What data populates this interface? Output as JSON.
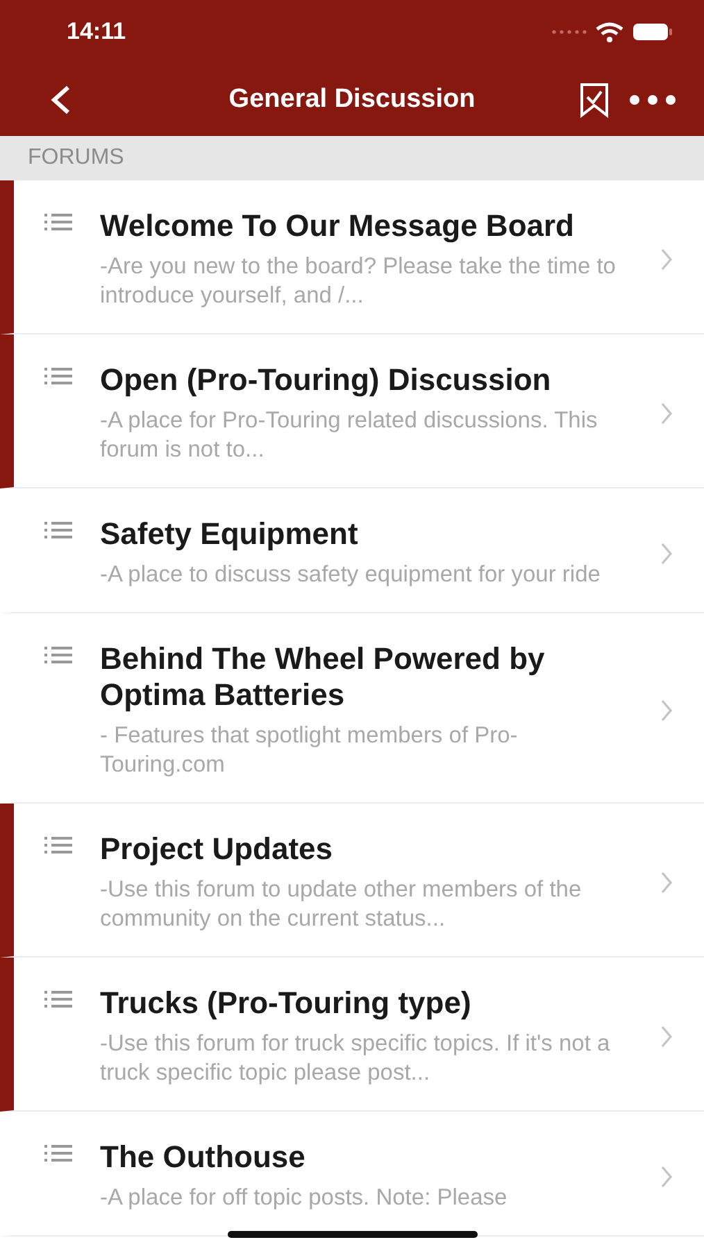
{
  "status_bar": {
    "time": "14:11"
  },
  "nav": {
    "title": "General Discussion"
  },
  "section": {
    "label": "FORUMS"
  },
  "forums": [
    {
      "title": "Welcome To Our Message Board",
      "description": "-Are you new to the board?  Please take the time to introduce yourself, and /...",
      "unread": true
    },
    {
      "title": "Open (Pro-Touring) Discussion",
      "description": "-A place for Pro-Touring related discussions. This forum is not to...",
      "unread": true
    },
    {
      "title": "Safety Equipment",
      "description": "-A place to discuss safety equipment for your ride",
      "unread": false
    },
    {
      "title": "Behind The Wheel Powered by Optima Batteries",
      "description": "- Features that spotlight members of Pro-Touring.com",
      "unread": false
    },
    {
      "title": "Project Updates",
      "description": "-Use this forum to update other members of the community on the current status...",
      "unread": true
    },
    {
      "title": "Trucks (Pro-Touring type)",
      "description": "-Use this forum for truck specific topics. If it's not a truck specific topic please post...",
      "unread": true
    },
    {
      "title": "The Outhouse",
      "description": "-A place for off topic posts.  Note: Please",
      "unread": false
    }
  ]
}
